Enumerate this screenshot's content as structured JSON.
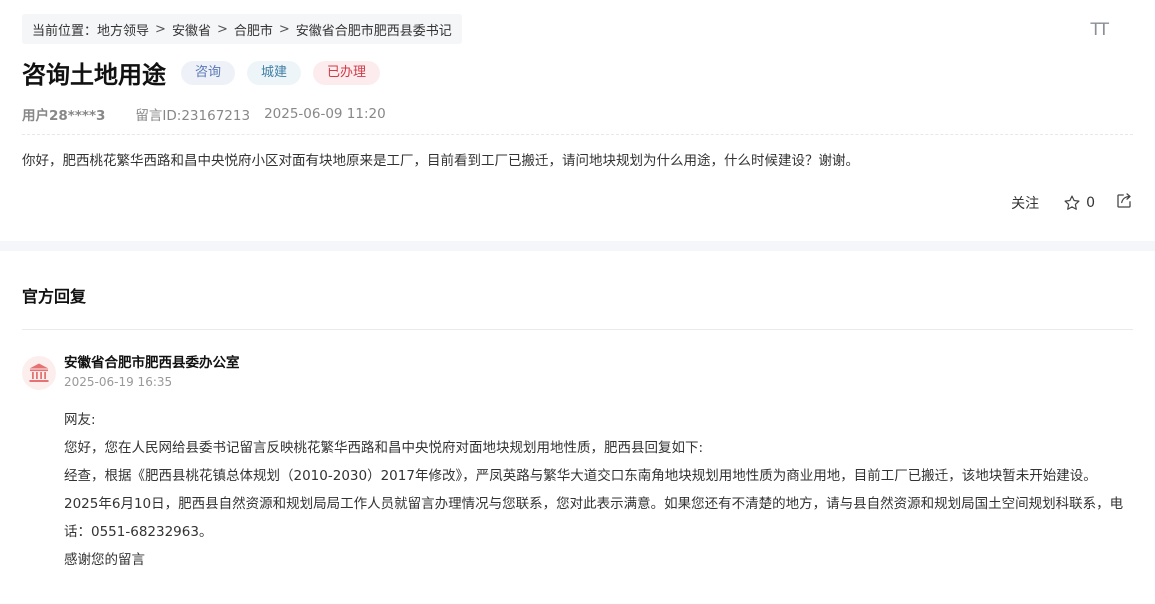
{
  "breadcrumb": {
    "prefix": "当前位置：",
    "items": [
      "地方领导",
      "安徽省",
      "合肥市",
      "安徽省合肥市肥西县委书记"
    ],
    "separator": ">"
  },
  "font_toggle_label": "TT",
  "post": {
    "title": "咨询土地用途",
    "tags": [
      "咨询",
      "城建",
      "已办理"
    ],
    "user": "用户28****3",
    "message_id": "留言ID:23167213",
    "datetime": "2025-06-09 11:20",
    "content": "你好，肥西桃花繁华西路和昌中央悦府小区对面有块地原来是工厂，目前看到工厂已搬迁，请问地块规划为什么用途，什么时候建设？谢谢。"
  },
  "actions": {
    "follow_label": "关注",
    "favorite_count": "0"
  },
  "reply": {
    "section_title": "官方回复",
    "org_name": "安徽省合肥市肥西县委办公室",
    "time": "2025-06-19 16:35",
    "paragraphs": [
      "网友:",
      "您好，您在人民网给县委书记留言反映桃花繁华西路和昌中央悦府对面地块规划用地性质，肥西县回复如下:",
      "经查，根据《肥西县桃花镇总体规划（2010-2030）2017年修改》，严凤英路与繁华大道交口东南角地块规划用地性质为商业用地，目前工厂已搬迁，该地块暂未开始建设。",
      "2025年6月10日，肥西县自然资源和规划局局工作人员就留言办理情况与您联系，您对此表示满意。如果您还有不清楚的地方，请与县自然资源和规划局国土空间规划科联系，电话：0551-68232963。",
      "感谢您的留言"
    ]
  },
  "colors": {
    "tag_consult": "#5a79b6",
    "tag_construction": "#3f7fa6",
    "tag_done": "#cf3b48",
    "avatar_icon": "#e57373"
  }
}
